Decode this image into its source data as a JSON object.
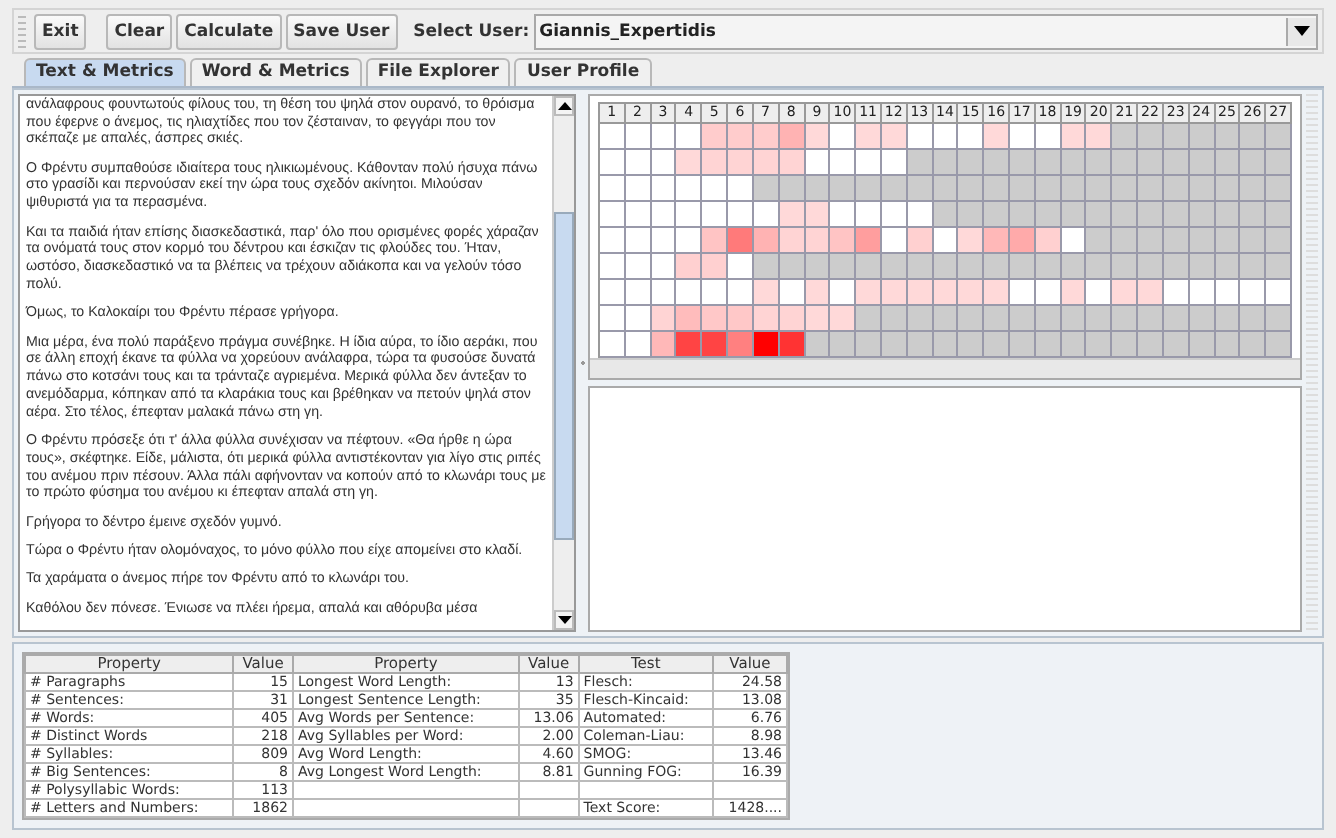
{
  "toolbar": {
    "buttons": [
      {
        "label": "Exit"
      },
      {
        "label": "Clear"
      },
      {
        "label": "Calculate"
      },
      {
        "label": "Save User"
      }
    ],
    "user_label": "Select User:",
    "user_value": "Giannis_Expertidis"
  },
  "tabs": [
    {
      "label": "Text & Metrics",
      "selected": true
    },
    {
      "label": "Word & Metrics",
      "selected": false
    },
    {
      "label": "File Explorer",
      "selected": false
    },
    {
      "label": "User Profile",
      "selected": false
    }
  ],
  "text_paragraphs": [
    "ανάλαφρους φουντωτούς φίλους του, τη θέση του ψηλά στον ουρανό, το θρόισμα που έφερνε ο άνεμος, τις ηλιαχτίδες που τον ζέσταιναν, το φεγγάρι που τον σκέπαζε με απαλές, άσπρες σκιές.",
    "Ο Φρέντυ συμπαθούσε ιδιαίτερα τους ηλικιωμένους. Κάθονταν πολύ ήσυχα πάνω στο γρασίδι και περνούσαν εκεί την ώρα τους σχεδόν ακίνητοι. Μιλούσαν ψιθυριστά για τα περασμένα.",
    "Και τα παιδιά ήταν επίσης διασκεδαστικά, παρ' όλο που ορισμένες φορές χάραζαν τα ονόματά τους στον κορμό του δέντρου και έσκιζαν τις φλούδες του. Ήταν, ωστόσο, διασκεδαστικό να τα βλέπεις να τρέχουν αδιάκοπα και να γελούν τόσο πολύ.",
    "Όμως, το Καλοκαίρι του Φρέντυ πέρασε γρήγορα.",
    "Μια μέρα, ένα πολύ παράξενο πράγμα συνέβηκε. Η ίδια αύρα, το ίδιο αεράκι, που σε άλλη εποχή έκανε τα φύλλα να χορεύουν ανάλαφρα, τώρα τα φυσούσε δυνατά πάνω στο κοτσάνι τους και τα τράνταζε αγριεμένα. Μερικά φύλλα δεν άντεξαν το ανεμόδαρμα, κόπηκαν από τα κλαράκια τους και βρέθηκαν να πετούν ψηλά στον αέρα. Στο τέλος, έπεφταν μαλακά πάνω στη γη.",
    "Ο Φρέντυ πρόσεξε ότι τ' άλλα φύλλα συνέχισαν να πέφτουν. «Θα ήρθε η ώρα τους», σκέφτηκε. Είδε, μάλιστα, ότι μερικά φύλλα αντιστέκονταν για λίγο στις ριπές του ανέμου πριν πέσουν. Άλλα πάλι αφήνονταν να κοπούν από το κλωνάρι τους με το πρώτο φύσημα του ανέμου κι έπεφταν απαλά στη γη.",
    "Γρήγορα το δέντρο έμεινε σχεδόν γυμνό.",
    "Τώρα ο Φρέντυ ήταν ολομόναχος, το μόνο φύλλο που είχε απομείνει στο κλαδί.",
    "Τα χαράματα ο άνεμος πήρε τον Φρέντυ από το κλωνάρι του.",
    "Καθόλου δεν πόνεσε. Ένιωσε να πλέει ήρεμα, απαλά και αθόρυβα μέσα"
  ],
  "heatmap": {
    "columns": [
      "1",
      "2",
      "3",
      "4",
      "5",
      "6",
      "7",
      "8",
      "9",
      "10",
      "11",
      "12",
      "13",
      "14",
      "15",
      "16",
      "17",
      "18",
      "19",
      "20",
      "21",
      "22",
      "23",
      "24",
      "25",
      "26",
      "27"
    ],
    "rows": [
      {
        "cells": [
          {
            "color": "#ffffff"
          },
          {
            "color": "#ffffff"
          },
          {
            "color": "#ffffff"
          },
          {
            "color": "#ffffff"
          },
          {
            "color": "#ffcccc"
          },
          {
            "color": "#ffcccc"
          },
          {
            "color": "#ffcccc"
          },
          {
            "color": "#ffb3b3"
          },
          {
            "color": "#ffd9d9"
          },
          {
            "color": "#ffffff"
          },
          {
            "color": "#ffd9d9"
          },
          {
            "color": "#ffd9d9"
          },
          {
            "color": "#ffffff"
          },
          {
            "color": "#ffffff"
          },
          {
            "color": "#ffffff"
          },
          {
            "color": "#ffd9d9"
          },
          {
            "color": "#ffffff"
          },
          {
            "color": "#ffffff"
          },
          {
            "color": "#ffd9d9"
          },
          {
            "color": "#ffd9d9"
          },
          {
            "color": "#cccccc"
          },
          {
            "color": "#cccccc"
          },
          {
            "color": "#cccccc"
          },
          {
            "color": "#cccccc"
          },
          {
            "color": "#cccccc"
          },
          {
            "color": "#cccccc"
          },
          {
            "color": "#cccccc"
          }
        ]
      },
      {
        "cells": [
          {
            "color": "#ffffff"
          },
          {
            "color": "#ffffff"
          },
          {
            "color": "#ffffff"
          },
          {
            "color": "#ffd9d9"
          },
          {
            "color": "#ffd4d4"
          },
          {
            "color": "#ffd4d4"
          },
          {
            "color": "#ffd4d4"
          },
          {
            "color": "#ffd4d4"
          },
          {
            "color": "#ffffff"
          },
          {
            "color": "#ffffff"
          },
          {
            "color": "#ffffff"
          },
          {
            "color": "#ffffff"
          },
          {
            "color": "#cccccc"
          },
          {
            "color": "#cccccc"
          },
          {
            "color": "#cccccc"
          },
          {
            "color": "#cccccc"
          },
          {
            "color": "#cccccc"
          },
          {
            "color": "#cccccc"
          },
          {
            "color": "#cccccc"
          },
          {
            "color": "#cccccc"
          },
          {
            "color": "#cccccc"
          },
          {
            "color": "#cccccc"
          },
          {
            "color": "#cccccc"
          },
          {
            "color": "#cccccc"
          },
          {
            "color": "#cccccc"
          },
          {
            "color": "#cccccc"
          },
          {
            "color": "#cccccc"
          }
        ]
      },
      {
        "cells": [
          {
            "color": "#ffffff"
          },
          {
            "color": "#ffffff"
          },
          {
            "color": "#ffffff"
          },
          {
            "color": "#ffffff"
          },
          {
            "color": "#ffffff"
          },
          {
            "color": "#ffffff"
          },
          {
            "color": "#cccccc"
          },
          {
            "color": "#cccccc"
          },
          {
            "color": "#cccccc"
          },
          {
            "color": "#cccccc"
          },
          {
            "color": "#cccccc"
          },
          {
            "color": "#cccccc"
          },
          {
            "color": "#cccccc"
          },
          {
            "color": "#cccccc"
          },
          {
            "color": "#cccccc"
          },
          {
            "color": "#cccccc"
          },
          {
            "color": "#cccccc"
          },
          {
            "color": "#cccccc"
          },
          {
            "color": "#cccccc"
          },
          {
            "color": "#cccccc"
          },
          {
            "color": "#cccccc"
          },
          {
            "color": "#cccccc"
          },
          {
            "color": "#cccccc"
          },
          {
            "color": "#cccccc"
          },
          {
            "color": "#cccccc"
          },
          {
            "color": "#cccccc"
          },
          {
            "color": "#cccccc"
          }
        ]
      },
      {
        "cells": [
          {
            "color": "#ffffff"
          },
          {
            "color": "#ffffff"
          },
          {
            "color": "#ffffff"
          },
          {
            "color": "#ffffff"
          },
          {
            "color": "#ffffff"
          },
          {
            "color": "#ffffff"
          },
          {
            "color": "#ffffff"
          },
          {
            "color": "#ffd9d9"
          },
          {
            "color": "#ffd9d9"
          },
          {
            "color": "#ffffff"
          },
          {
            "color": "#ffffff"
          },
          {
            "color": "#ffffff"
          },
          {
            "color": "#ffffff"
          },
          {
            "color": "#cccccc"
          },
          {
            "color": "#cccccc"
          },
          {
            "color": "#cccccc"
          },
          {
            "color": "#cccccc"
          },
          {
            "color": "#cccccc"
          },
          {
            "color": "#cccccc"
          },
          {
            "color": "#cccccc"
          },
          {
            "color": "#cccccc"
          },
          {
            "color": "#cccccc"
          },
          {
            "color": "#cccccc"
          },
          {
            "color": "#cccccc"
          },
          {
            "color": "#cccccc"
          },
          {
            "color": "#cccccc"
          },
          {
            "color": "#cccccc"
          }
        ]
      },
      {
        "cells": [
          {
            "color": "#ffffff"
          },
          {
            "color": "#ffffff"
          },
          {
            "color": "#ffffff"
          },
          {
            "color": "#ffffff"
          },
          {
            "color": "#ffc4c4"
          },
          {
            "color": "#ff7a7a"
          },
          {
            "color": "#ffb3b3"
          },
          {
            "color": "#ffd4d4"
          },
          {
            "color": "#ffd4d4"
          },
          {
            "color": "#ffc4c4"
          },
          {
            "color": "#ff9e9e"
          },
          {
            "color": "#ffffff"
          },
          {
            "color": "#ffd0d0"
          },
          {
            "color": "#ffffff"
          },
          {
            "color": "#ffd9d9"
          },
          {
            "color": "#ffb8b8"
          },
          {
            "color": "#ffaaaa"
          },
          {
            "color": "#ffd0d0"
          },
          {
            "color": "#ffffff"
          },
          {
            "color": "#cccccc"
          },
          {
            "color": "#cccccc"
          },
          {
            "color": "#cccccc"
          },
          {
            "color": "#cccccc"
          },
          {
            "color": "#cccccc"
          },
          {
            "color": "#cccccc"
          },
          {
            "color": "#cccccc"
          },
          {
            "color": "#cccccc"
          }
        ]
      },
      {
        "cells": [
          {
            "color": "#ffffff"
          },
          {
            "color": "#ffffff"
          },
          {
            "color": "#ffffff"
          },
          {
            "color": "#ffd0d0"
          },
          {
            "color": "#ffd0d0"
          },
          {
            "color": "#ffffff"
          },
          {
            "color": "#cccccc"
          },
          {
            "color": "#cccccc"
          },
          {
            "color": "#cccccc"
          },
          {
            "color": "#cccccc"
          },
          {
            "color": "#cccccc"
          },
          {
            "color": "#cccccc"
          },
          {
            "color": "#cccccc"
          },
          {
            "color": "#cccccc"
          },
          {
            "color": "#cccccc"
          },
          {
            "color": "#cccccc"
          },
          {
            "color": "#cccccc"
          },
          {
            "color": "#cccccc"
          },
          {
            "color": "#cccccc"
          },
          {
            "color": "#cccccc"
          },
          {
            "color": "#cccccc"
          },
          {
            "color": "#cccccc"
          },
          {
            "color": "#cccccc"
          },
          {
            "color": "#cccccc"
          },
          {
            "color": "#cccccc"
          },
          {
            "color": "#cccccc"
          },
          {
            "color": "#cccccc"
          }
        ]
      },
      {
        "cells": [
          {
            "color": "#ffffff"
          },
          {
            "color": "#ffffff"
          },
          {
            "color": "#ffffff"
          },
          {
            "color": "#ffffff"
          },
          {
            "color": "#ffffff"
          },
          {
            "color": "#ffffff"
          },
          {
            "color": "#ffd9d9"
          },
          {
            "color": "#ffffff"
          },
          {
            "color": "#ffd9d9"
          },
          {
            "color": "#ffffff"
          },
          {
            "color": "#ffd9d9"
          },
          {
            "color": "#ffd9d9"
          },
          {
            "color": "#ffd9d9"
          },
          {
            "color": "#ffd9d9"
          },
          {
            "color": "#ffd9d9"
          },
          {
            "color": "#ffd9d9"
          },
          {
            "color": "#ffffff"
          },
          {
            "color": "#ffffff"
          },
          {
            "color": "#ffd9d9"
          },
          {
            "color": "#ffffff"
          },
          {
            "color": "#ffd9d9"
          },
          {
            "color": "#ffd9d9"
          },
          {
            "color": "#ffffff"
          },
          {
            "color": "#ffffff"
          },
          {
            "color": "#ffffff"
          },
          {
            "color": "#ffffff"
          },
          {
            "color": "#ffffff"
          }
        ]
      },
      {
        "cells": [
          {
            "color": "#ffffff"
          },
          {
            "color": "#ffffff"
          },
          {
            "color": "#ffd4d4"
          },
          {
            "color": "#ffbcbc"
          },
          {
            "color": "#ffc8c8"
          },
          {
            "color": "#ffc8c8"
          },
          {
            "color": "#ffd4d4"
          },
          {
            "color": "#ffd4d4"
          },
          {
            "color": "#ffd9d9"
          },
          {
            "color": "#ffd9d9"
          },
          {
            "color": "#cccccc"
          },
          {
            "color": "#cccccc"
          },
          {
            "color": "#cccccc"
          },
          {
            "color": "#cccccc"
          },
          {
            "color": "#cccccc"
          },
          {
            "color": "#cccccc"
          },
          {
            "color": "#cccccc"
          },
          {
            "color": "#cccccc"
          },
          {
            "color": "#cccccc"
          },
          {
            "color": "#cccccc"
          },
          {
            "color": "#cccccc"
          },
          {
            "color": "#cccccc"
          },
          {
            "color": "#cccccc"
          },
          {
            "color": "#cccccc"
          },
          {
            "color": "#cccccc"
          },
          {
            "color": "#cccccc"
          },
          {
            "color": "#cccccc"
          }
        ]
      },
      {
        "cells": [
          {
            "color": "#ffffff"
          },
          {
            "color": "#ffffff"
          },
          {
            "color": "#ffb8b8"
          },
          {
            "color": "#ff4444"
          },
          {
            "color": "#ff4444"
          },
          {
            "color": "#ff8080"
          },
          {
            "color": "#ff0000"
          },
          {
            "color": "#ff3333"
          },
          {
            "color": "#cccccc"
          },
          {
            "color": "#cccccc"
          },
          {
            "color": "#cccccc"
          },
          {
            "color": "#cccccc"
          },
          {
            "color": "#cccccc"
          },
          {
            "color": "#cccccc"
          },
          {
            "color": "#cccccc"
          },
          {
            "color": "#cccccc"
          },
          {
            "color": "#cccccc"
          },
          {
            "color": "#cccccc"
          },
          {
            "color": "#cccccc"
          },
          {
            "color": "#cccccc"
          },
          {
            "color": "#cccccc"
          },
          {
            "color": "#cccccc"
          },
          {
            "color": "#cccccc"
          },
          {
            "color": "#cccccc"
          },
          {
            "color": "#cccccc"
          },
          {
            "color": "#cccccc"
          },
          {
            "color": "#cccccc"
          }
        ]
      }
    ]
  },
  "metrics_table": {
    "columns": [
      "Property",
      "Value",
      "Property",
      "Value",
      "Test",
      "Value"
    ],
    "rows": [
      [
        "# Paragraphs",
        "15",
        "Longest Word Length:",
        "13",
        "Flesch:",
        "24.58"
      ],
      [
        "# Sentences:",
        "31",
        "Longest Sentence Length:",
        "35",
        "Flesch-Kincaid:",
        "13.08"
      ],
      [
        "# Words:",
        "405",
        "Avg Words per Sentence:",
        "13.06",
        "Automated:",
        "6.76"
      ],
      [
        "# Distinct Words",
        "218",
        "Avg Syllables per Word:",
        "2.00",
        "Coleman-Liau:",
        "8.98"
      ],
      [
        "# Syllables:",
        "809",
        "Avg Word Length:",
        "4.60",
        "SMOG:",
        "13.46"
      ],
      [
        "# Big Sentences:",
        "8",
        "Avg Longest Word Length:",
        "8.81",
        "Gunning FOG:",
        "16.39"
      ],
      [
        "# Polysyllabic Words:",
        "113",
        "",
        "",
        "",
        ""
      ],
      [
        "# Letters and Numbers:",
        "1862",
        "",
        "",
        "Text Score:",
        "1428...."
      ]
    ]
  }
}
